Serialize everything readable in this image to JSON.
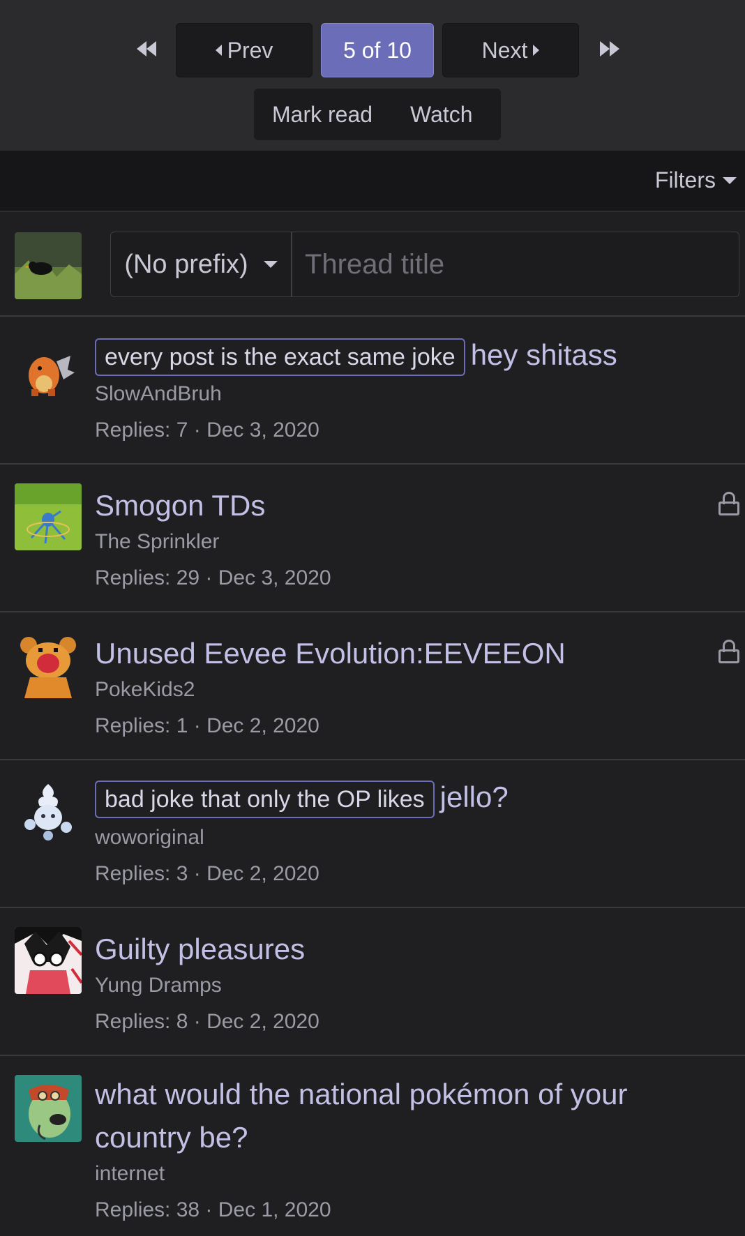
{
  "pager": {
    "prev_label": "Prev",
    "current_label": "5 of 10",
    "next_label": "Next"
  },
  "actions": {
    "mark_read": "Mark read",
    "watch": "Watch"
  },
  "filters": {
    "label": "Filters"
  },
  "new_thread": {
    "prefix": "(No prefix)",
    "title_placeholder": "Thread title"
  },
  "threads": [
    {
      "label": "every post is the exact same joke",
      "title": "hey shitass",
      "author": "SlowAndBruh",
      "replies": "Replies: 7",
      "date": "Dec 3, 2020",
      "locked": false
    },
    {
      "label": "",
      "title": "Smogon TDs",
      "author": "The Sprinkler",
      "replies": "Replies: 29",
      "date": "Dec 3, 2020",
      "locked": true
    },
    {
      "label": "",
      "title": "Unused Eevee Evolution:EEVEEON",
      "author": "PokeKids2",
      "replies": "Replies: 1",
      "date": "Dec 2, 2020",
      "locked": true
    },
    {
      "label": "bad joke that only the OP likes",
      "title": "jello?",
      "author": "woworiginal",
      "replies": "Replies: 3",
      "date": "Dec 2, 2020",
      "locked": false
    },
    {
      "label": "",
      "title": "Guilty pleasures",
      "author": "Yung Dramps",
      "replies": "Replies: 8",
      "date": "Dec 2, 2020",
      "locked": false
    },
    {
      "label": "",
      "title": "what would the national pokémon of your country be?",
      "author": "internet",
      "replies": "Replies: 38",
      "date": "Dec 1, 2020",
      "locked": false
    }
  ],
  "colors": {
    "accent": "#6b6db8",
    "title_text": "#c3c0e6",
    "background": "#1f1f21"
  }
}
